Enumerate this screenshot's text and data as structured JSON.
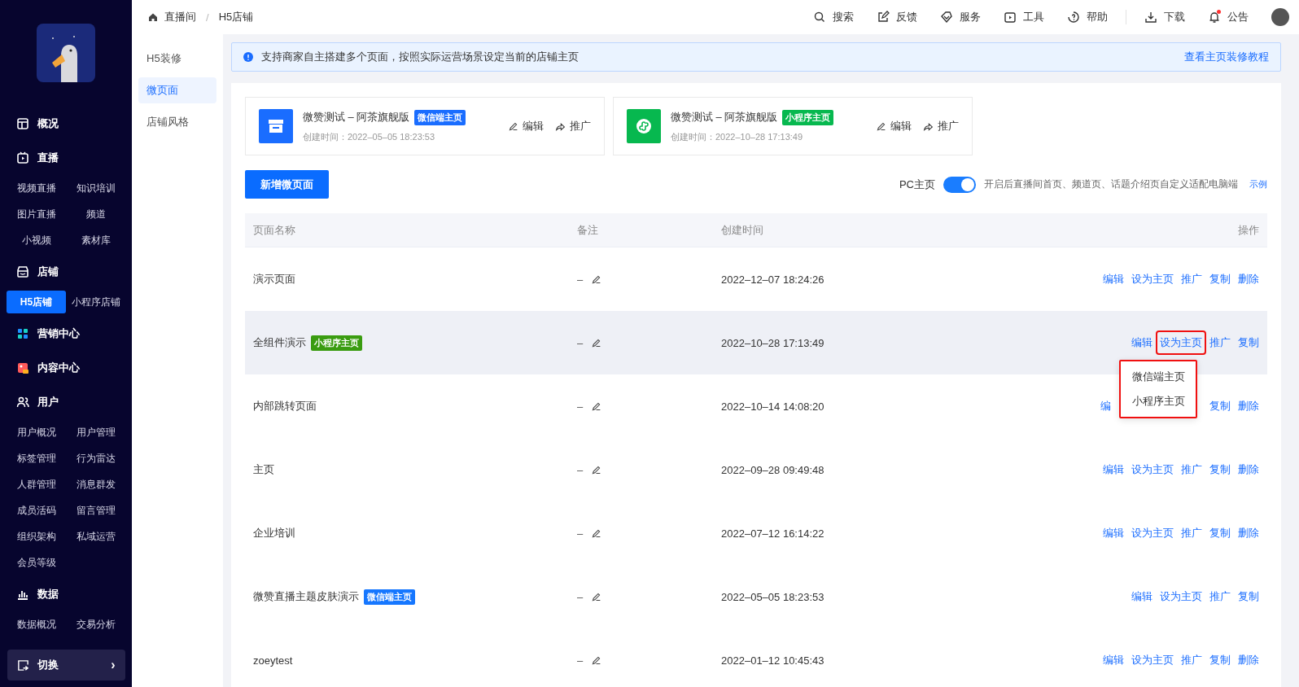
{
  "sidebar": {
    "groups": [
      {
        "label": "概况"
      },
      {
        "label": "直播",
        "items": [
          {
            "label": "视频直播",
            "selected": false
          },
          {
            "label": "知识培训",
            "selected": false
          },
          {
            "label": "图片直播",
            "selected": false
          },
          {
            "label": "频道",
            "selected": false
          },
          {
            "label": "小视频",
            "selected": false
          },
          {
            "label": "素材库",
            "selected": false
          }
        ]
      },
      {
        "label": "店铺",
        "items": [
          {
            "label": "H5店铺",
            "selected": true
          },
          {
            "label": "小程序店铺",
            "selected": false
          }
        ]
      },
      {
        "label": "营销中心"
      },
      {
        "label": "内容中心"
      },
      {
        "label": "用户",
        "items": [
          {
            "label": "用户概况",
            "selected": false
          },
          {
            "label": "用户管理",
            "selected": false
          },
          {
            "label": "标签管理",
            "selected": false
          },
          {
            "label": "行为雷达",
            "selected": false
          },
          {
            "label": "人群管理",
            "selected": false
          },
          {
            "label": "消息群发",
            "selected": false
          },
          {
            "label": "成员活码",
            "selected": false
          },
          {
            "label": "留言管理",
            "selected": false
          },
          {
            "label": "组织架构",
            "selected": false
          },
          {
            "label": "私域运营",
            "selected": false
          },
          {
            "label": "会员等级",
            "selected": false
          }
        ]
      },
      {
        "label": "数据",
        "items": [
          {
            "label": "数据概况",
            "selected": false
          },
          {
            "label": "交易分析",
            "selected": false
          }
        ]
      }
    ],
    "switch_button": {
      "label": "切换",
      "chevron": "›"
    }
  },
  "breadcrumb": {
    "separator": "/",
    "items": [
      "直播间",
      "H5店铺"
    ]
  },
  "toolbar": {
    "tools": [
      {
        "label": "搜索"
      },
      {
        "label": "反馈"
      },
      {
        "label": "服务"
      },
      {
        "label": "工具"
      },
      {
        "label": "帮助"
      },
      {
        "label": "下载"
      },
      {
        "label": "公告",
        "notification": true
      }
    ]
  },
  "subnav": {
    "items": [
      {
        "label": "H5装修",
        "selected": false
      },
      {
        "label": "微页面",
        "selected": true
      },
      {
        "label": "店铺风格",
        "selected": false
      }
    ]
  },
  "notice": {
    "text": "支持商家自主搭建多个页面，按照实际运营场景设定当前的店铺主页",
    "link": "查看主页装修教程"
  },
  "home_cards": [
    {
      "title": "微赞测试 – 阿茶旗舰版",
      "badge": {
        "label": "微信端主页",
        "kind": "wechat"
      },
      "created": "创建时间：2022–05–05 18:23:53",
      "actions": [
        "编辑",
        "推广"
      ]
    },
    {
      "title": "微赞测试 – 阿茶旗舰版",
      "badge": {
        "label": "小程序主页",
        "kind": "miniprogram"
      },
      "created": "创建时间：2022–10–28 17:13:49",
      "actions": [
        "编辑",
        "推广"
      ]
    }
  ],
  "add_button": "新增微页面",
  "pc_home": {
    "label": "PC主页",
    "on": true,
    "description": "开启后直播间首页、频道页、话题介绍页自定义适配电脑端",
    "link": "示例"
  },
  "table": {
    "columns": [
      "页面名称",
      "备注",
      "创建时间",
      "操作"
    ],
    "rows": [
      {
        "name": "演示页面",
        "note": "–",
        "created": "2022–12–07 18:24:26",
        "highlighted": false,
        "actions": [
          {
            "label": "编辑",
            "marked": false
          },
          {
            "label": "设为主页",
            "marked": false
          },
          {
            "label": "推广",
            "marked": false
          },
          {
            "label": "复制",
            "marked": false
          },
          {
            "label": "删除",
            "marked": false
          }
        ]
      },
      {
        "name": "全组件演示",
        "badge": {
          "label": "小程序主页",
          "kind": "miniprogram"
        },
        "note": "–",
        "created": "2022–10–28 17:13:49",
        "highlighted": true,
        "actions": [
          {
            "label": "编辑",
            "marked": false
          },
          {
            "label": "设为主页",
            "marked": true,
            "menu": [
              "微信端主页",
              "小程序主页"
            ]
          },
          {
            "label": "推广",
            "marked": false
          },
          {
            "label": "复制",
            "marked": false
          }
        ]
      },
      {
        "name": "内部跳转页面",
        "note": "–",
        "created": "2022–10–14 14:08:20",
        "highlighted": false,
        "actions": [
          {
            "label": "编",
            "marked": false
          },
          {
            "label": "复制",
            "marked": false
          },
          {
            "label": "删除",
            "marked": false
          }
        ]
      },
      {
        "name": "主页",
        "note": "–",
        "created": "2022–09–28 09:49:48",
        "highlighted": false,
        "actions": [
          {
            "label": "编辑",
            "marked": false
          },
          {
            "label": "设为主页",
            "marked": false
          },
          {
            "label": "推广",
            "marked": false
          },
          {
            "label": "复制",
            "marked": false
          },
          {
            "label": "删除",
            "marked": false
          }
        ]
      },
      {
        "name": "企业培训",
        "note": "–",
        "created": "2022–07–12 16:14:22",
        "highlighted": false,
        "actions": [
          {
            "label": "编辑",
            "marked": false
          },
          {
            "label": "设为主页",
            "marked": false
          },
          {
            "label": "推广",
            "marked": false
          },
          {
            "label": "复制",
            "marked": false
          },
          {
            "label": "删除",
            "marked": false
          }
        ]
      },
      {
        "name": "微赞直播主题皮肤演示",
        "badge": {
          "label": "微信端主页",
          "kind": "wechat"
        },
        "note": "–",
        "created": "2022–05–05 18:23:53",
        "highlighted": false,
        "actions": [
          {
            "label": "编辑",
            "marked": false
          },
          {
            "label": "设为主页",
            "marked": false
          },
          {
            "label": "推广",
            "marked": false
          },
          {
            "label": "复制",
            "marked": false
          }
        ]
      },
      {
        "name": "zoeytest",
        "note": "–",
        "created": "2022–01–12 10:45:43",
        "highlighted": false,
        "actions": [
          {
            "label": "编辑",
            "marked": false
          },
          {
            "label": "设为主页",
            "marked": false
          },
          {
            "label": "推广",
            "marked": false
          },
          {
            "label": "复制",
            "marked": false
          },
          {
            "label": "删除",
            "marked": false
          }
        ]
      }
    ]
  }
}
